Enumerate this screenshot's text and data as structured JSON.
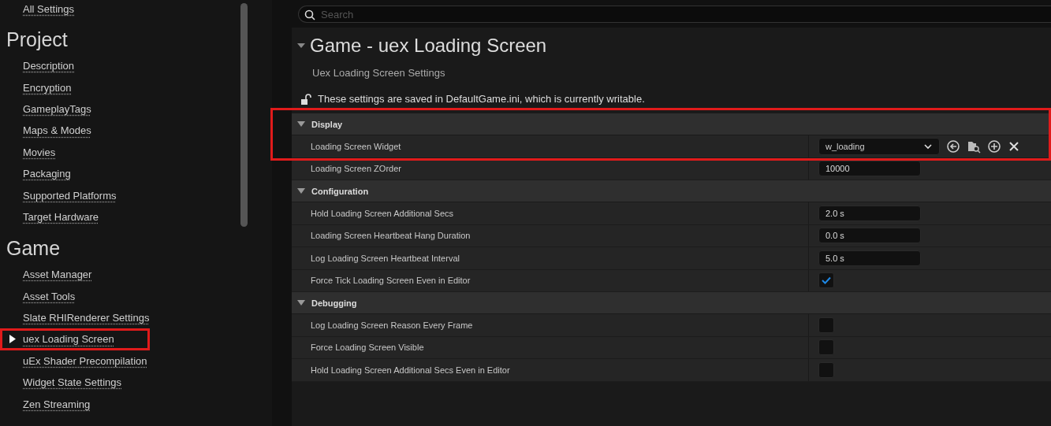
{
  "sidebar": {
    "top_link": "All Settings",
    "sections": [
      {
        "title": "Project",
        "items": [
          {
            "label": "Description",
            "selected": false,
            "highlighted": false
          },
          {
            "label": "Encryption",
            "selected": false,
            "highlighted": false
          },
          {
            "label": "GameplayTags",
            "selected": false,
            "highlighted": false
          },
          {
            "label": "Maps & Modes",
            "selected": false,
            "highlighted": false
          },
          {
            "label": "Movies",
            "selected": false,
            "highlighted": false
          },
          {
            "label": "Packaging",
            "selected": false,
            "highlighted": false
          },
          {
            "label": "Supported Platforms",
            "selected": false,
            "highlighted": false
          },
          {
            "label": "Target Hardware",
            "selected": false,
            "highlighted": false
          }
        ]
      },
      {
        "title": "Game",
        "items": [
          {
            "label": "Asset Manager",
            "selected": false,
            "highlighted": false
          },
          {
            "label": "Asset Tools",
            "selected": false,
            "highlighted": false
          },
          {
            "label": "Slate RHIRenderer Settings",
            "selected": false,
            "highlighted": false
          },
          {
            "label": "uex Loading Screen",
            "selected": true,
            "highlighted": true
          },
          {
            "label": "uEx Shader Precompilation",
            "selected": false,
            "highlighted": false
          },
          {
            "label": "Widget State Settings",
            "selected": false,
            "highlighted": false
          },
          {
            "label": "Zen Streaming",
            "selected": false,
            "highlighted": false
          }
        ]
      }
    ]
  },
  "search": {
    "placeholder": "Search"
  },
  "page": {
    "title": "Game - uex Loading Screen",
    "expanded": true,
    "subtitle": "Uex Loading Screen Settings",
    "notice": "These settings are saved in DefaultGame.ini, which is currently writable."
  },
  "categories": [
    {
      "name": "Display",
      "expanded": true,
      "highlighted": true,
      "rows": [
        {
          "label": "Loading Screen Widget",
          "kind": "asset",
          "value": "w_loading",
          "highlighted": true
        },
        {
          "label": "Loading Screen ZOrder",
          "kind": "text",
          "value": "10000",
          "highlighted": false
        }
      ]
    },
    {
      "name": "Configuration",
      "expanded": true,
      "highlighted": false,
      "rows": [
        {
          "label": "Hold Loading Screen Additional Secs",
          "kind": "text",
          "value": "2.0 s",
          "highlighted": false
        },
        {
          "label": "Loading Screen Heartbeat Hang Duration",
          "kind": "text",
          "value": "0.0 s",
          "highlighted": false
        },
        {
          "label": "Log Loading Screen Heartbeat Interval",
          "kind": "text",
          "value": "5.0 s",
          "highlighted": false
        },
        {
          "label": "Force Tick Loading Screen Even in Editor",
          "kind": "checkbox",
          "checked": true,
          "highlighted": false
        }
      ]
    },
    {
      "name": "Debugging",
      "expanded": true,
      "highlighted": false,
      "rows": [
        {
          "label": "Log Loading Screen Reason Every Frame",
          "kind": "checkbox",
          "checked": false,
          "highlighted": false
        },
        {
          "label": "Force Loading Screen Visible",
          "kind": "checkbox",
          "checked": false,
          "highlighted": false
        },
        {
          "label": "Hold Loading Screen Additional Secs Even in Editor",
          "kind": "checkbox",
          "checked": false,
          "highlighted": false
        }
      ]
    }
  ]
}
